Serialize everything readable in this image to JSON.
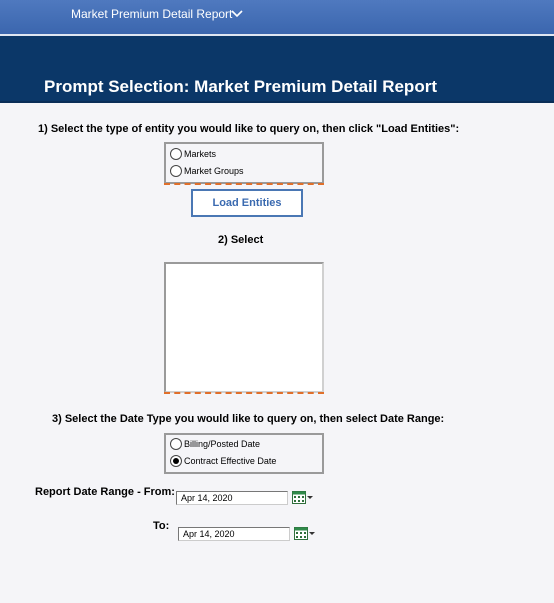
{
  "topbar": {
    "title": "Market Premium Detail Report"
  },
  "header": {
    "title": "Prompt Selection:  Market Premium Detail Report"
  },
  "step1": {
    "text": "1)  Select the type of entity you would like to query on, then click \"Load Entities\":",
    "options": [
      {
        "label": "Markets",
        "selected": false
      },
      {
        "label": "Market Groups",
        "selected": false
      }
    ]
  },
  "load_button": "Load Entities",
  "step2": {
    "text": "2)  Select"
  },
  "step3": {
    "text": "3)  Select the Date Type you would like to query on, then select Date Range:",
    "options": [
      {
        "label": "Billing/Posted Date",
        "selected": false
      },
      {
        "label": "Contract Effective Date",
        "selected": true
      }
    ]
  },
  "date_range": {
    "from_label": "Report Date Range - From:",
    "from_value": "Apr 14, 2020",
    "to_label": "To:",
    "to_value": "Apr 14, 2020"
  },
  "colors": {
    "header_bg": "#0b3768",
    "topbar_bg": "#4f79bf",
    "accent_dashed": "#e06f2a",
    "button_text": "#3a6ab0"
  }
}
